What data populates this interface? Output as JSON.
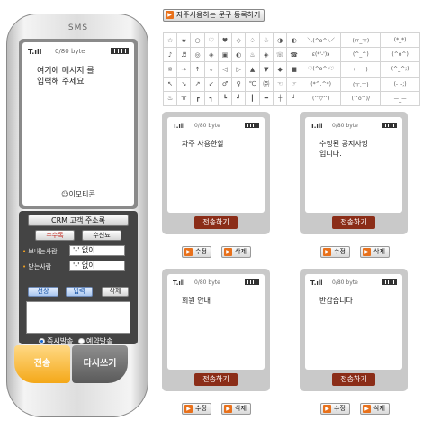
{
  "phone": {
    "title": "SMS",
    "signal": "T.ıll",
    "bytes": "0/80 byte",
    "message": "여기에 메시지 를\n입력해 주세요",
    "emoticon_label": "☺이모티콘",
    "crm_button": "CRM 고객 주소록",
    "recipient_btn": "수수록",
    "received_btn": "수신뇨",
    "sender_label": "보내는사람",
    "sender_value": "'-' 없이",
    "receiver_label": "받는사람",
    "receiver_value": "'-' 없이",
    "tab_select": "선상",
    "tab_add": "입력",
    "tab_delete": "삭제",
    "radio_now": "즉시발송",
    "radio_reserve": "예약발송",
    "send": "전송",
    "rewrite": "다시쓰기"
  },
  "register_button": "자주사용하는 문구 등록하기",
  "emoticon_rows": [
    [
      "☆",
      "★",
      "○",
      "♡",
      "♥",
      "◇",
      "♤",
      "♧",
      "◑",
      "◐",
      "＼(^o^)／",
      "(ㅠ_ㅠ)",
      "(*_*)"
    ],
    [
      "♪",
      "♬",
      "◎",
      "◈",
      "▣",
      "◐",
      "♨",
      "◈",
      "☏",
      "☎",
      "ε(*'-')э",
      "(^_^)",
      "(^o^)"
    ],
    [
      "※",
      "→",
      "↑",
      "↓",
      "◁",
      "▷",
      "▲",
      "▼",
      "◆",
      "■",
      "♡(^o^)♡",
      "(ㅡㅡ)",
      "(^_^;)"
    ],
    [
      "↖",
      "↘",
      "↗",
      "↙",
      "♂",
      "♀",
      "℃",
      "㈜",
      "☜",
      "☞",
      "(*^.^*)",
      "(ㅜ.ㅜ)",
      "(-_-;)"
    ],
    [
      "♨",
      "ㅠ",
      "┏",
      "┓",
      "┗",
      "┛",
      "┃",
      "━",
      "┼",
      "┘",
      "(^▽^)",
      "(^o^)/",
      "ㅡ_ㅡ"
    ]
  ],
  "cards": [
    {
      "signal": "T.ıll",
      "bytes": "0/80 byte",
      "message": "자주 사용한할",
      "send": "전송하기",
      "edit": "수정",
      "delete": "삭제"
    },
    {
      "signal": "T.ıll",
      "bytes": "0/80 byte",
      "message": "수정된 공지사항\n입니다.",
      "send": "전송하기",
      "edit": "수정",
      "delete": "삭제"
    },
    {
      "signal": "T.ıll",
      "bytes": "0/80 byte",
      "message": "회원 안내",
      "send": "전송하기",
      "edit": "수정",
      "delete": "삭제"
    },
    {
      "signal": "T.ıll",
      "bytes": "0/80 byte",
      "message": "반갑습니다",
      "send": "전송하기",
      "edit": "수정",
      "delete": "삭제"
    }
  ]
}
